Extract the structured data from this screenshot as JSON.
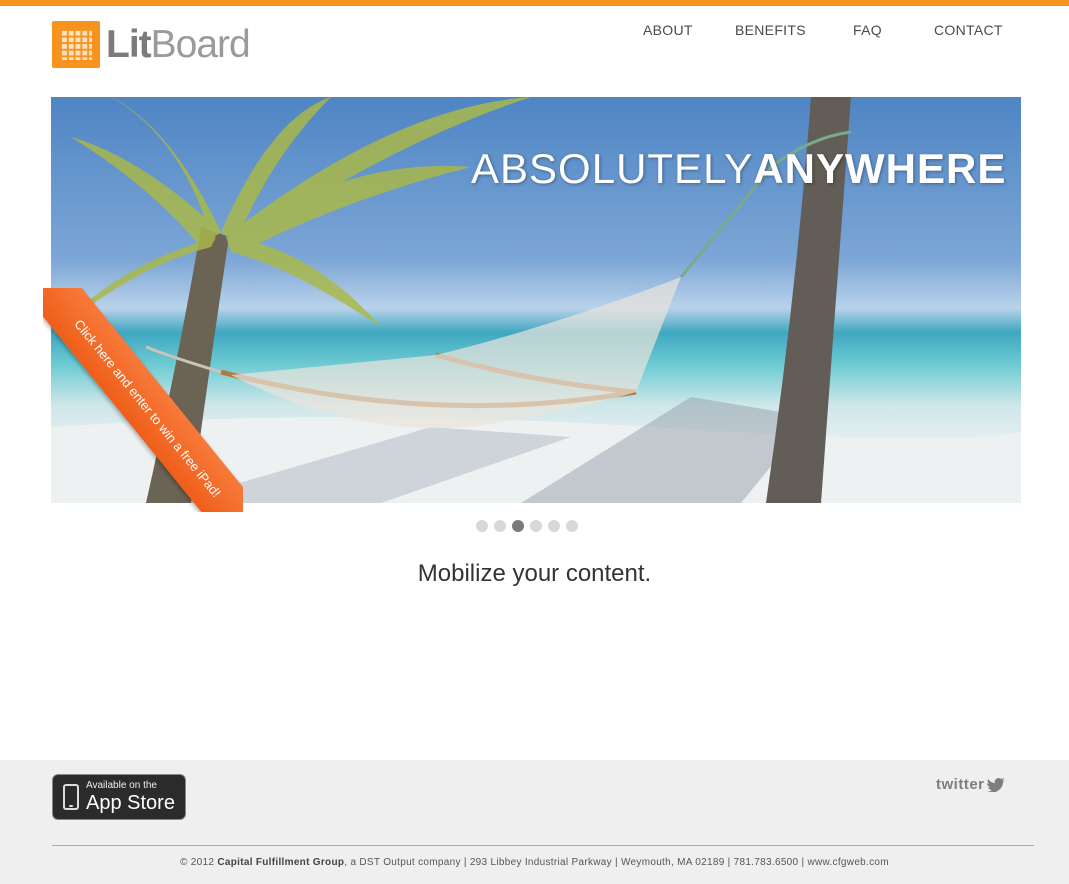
{
  "brand": {
    "logo_lit": "Lit",
    "logo_board": "Board",
    "accent": "#f7941d"
  },
  "nav": [
    {
      "label": "ABOUT"
    },
    {
      "label": "BENEFITS"
    },
    {
      "label": "FAQ"
    },
    {
      "label": "CONTACT"
    }
  ],
  "hero": {
    "headline_light": "ABSOLUTELY",
    "headline_bold": "ANYWHERE",
    "ribbon_text": "Click here and enter to win a free iPad!",
    "ribbon_color": "#ef5e19",
    "slide_count": 6,
    "active_slide": 3
  },
  "tagline": "Mobilize your content.",
  "footer": {
    "appstore_small": "Available on the",
    "appstore_big": "App Store",
    "twitter_label": "twitter",
    "copyright_prefix": "© 2012 ",
    "copyright_company": "Capital Fulfillment Group",
    "copyright_rest": ", a DST Output company | 293 Libbey Industrial Parkway | Weymouth, MA 02189 | 781.783.6500 | www.cfgweb.com"
  }
}
